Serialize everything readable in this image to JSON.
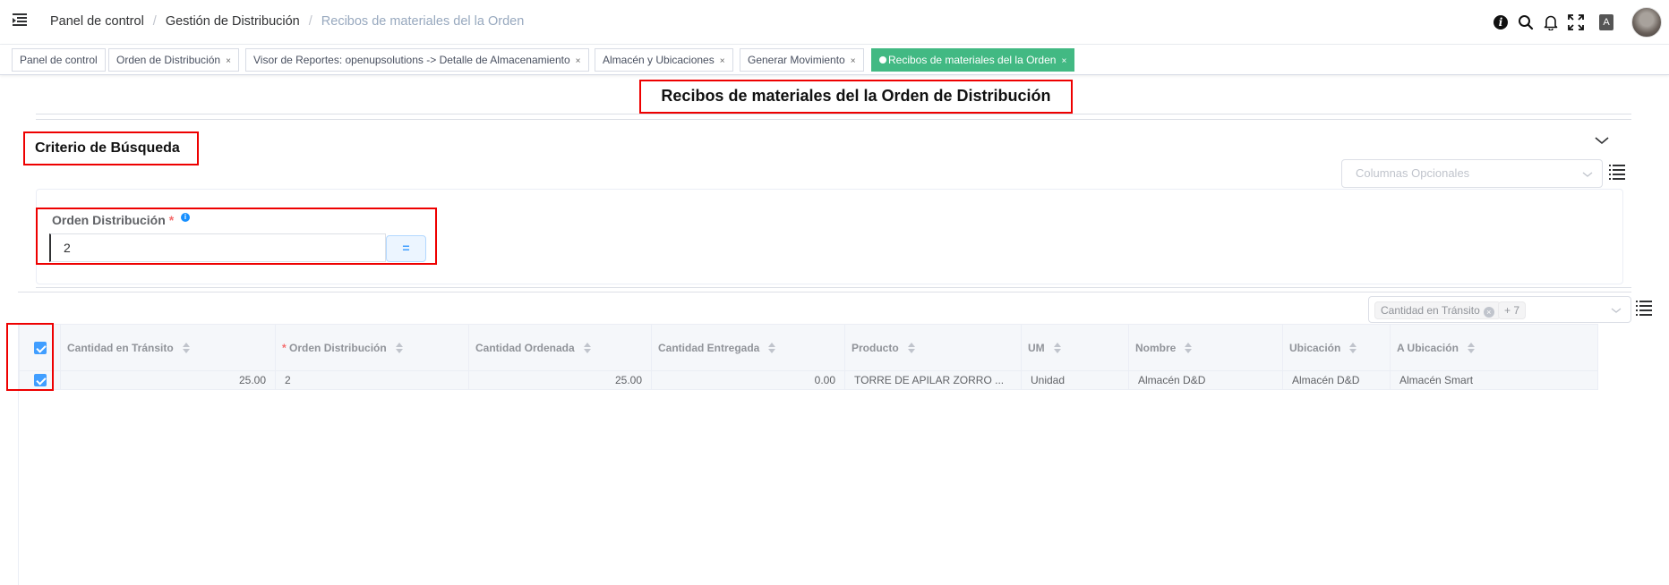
{
  "header": {
    "breadcrumb": [
      "Panel de control",
      "Gestión de Distribución",
      "Recibos de materiales del la Orden"
    ],
    "language_icon_label": "A"
  },
  "tags": [
    {
      "label": "Panel de control",
      "closable": false,
      "active": false
    },
    {
      "label": "Orden de Distribución",
      "closable": true,
      "active": false
    },
    {
      "label": "Visor de Reportes: openupsolutions -> Detalle de Almacenamiento",
      "closable": true,
      "active": false
    },
    {
      "label": "Almacén y Ubicaciones",
      "closable": true,
      "active": false
    },
    {
      "label": "Generar Movimiento",
      "closable": true,
      "active": false
    },
    {
      "label": "Recibos de materiales del la Orden",
      "closable": true,
      "active": true
    }
  ],
  "close_glyph": "×",
  "page_title": "Recibos de materiales del la Orden de Distribución",
  "search": {
    "title": "Criterio de Búsqueda",
    "optional_columns_placeholder": "Columnas Opcionales",
    "field_label": "Orden Distribución",
    "required_mark": "*",
    "info_glyph": "i",
    "field_value": "2",
    "operator": "="
  },
  "table_columns_select": {
    "selected_tag": "Cantidad en Tránsito",
    "more_tag": "+ 7"
  },
  "table": {
    "headers": [
      "Cantidad en Tránsito",
      "Orden Distribución",
      "Cantidad Ordenada",
      "Cantidad Entregada",
      "Producto",
      "UM",
      "Nombre",
      "Ubicación",
      "A Ubicación"
    ],
    "rows": [
      {
        "selected": true,
        "cells": [
          "25.00",
          "2",
          "25.00",
          "0.00",
          "TORRE DE APILAR ZORRO ...",
          "Unidad",
          "Almacén D&D",
          "Almacén D&D",
          "Almacén Smart"
        ]
      }
    ]
  },
  "icons": {
    "menu": "hamburger-icon",
    "info": "info-icon",
    "search": "search-icon",
    "bell": "bell-icon",
    "fullscreen": "fullscreen-icon",
    "language": "language-icon",
    "collapse": "chevron-down-icon",
    "list": "list-icon"
  },
  "colors": {
    "active_tag": "#42b983",
    "highlight_border": "#ee0000",
    "checkbox": "#409eff",
    "required": "#f56c6c"
  }
}
